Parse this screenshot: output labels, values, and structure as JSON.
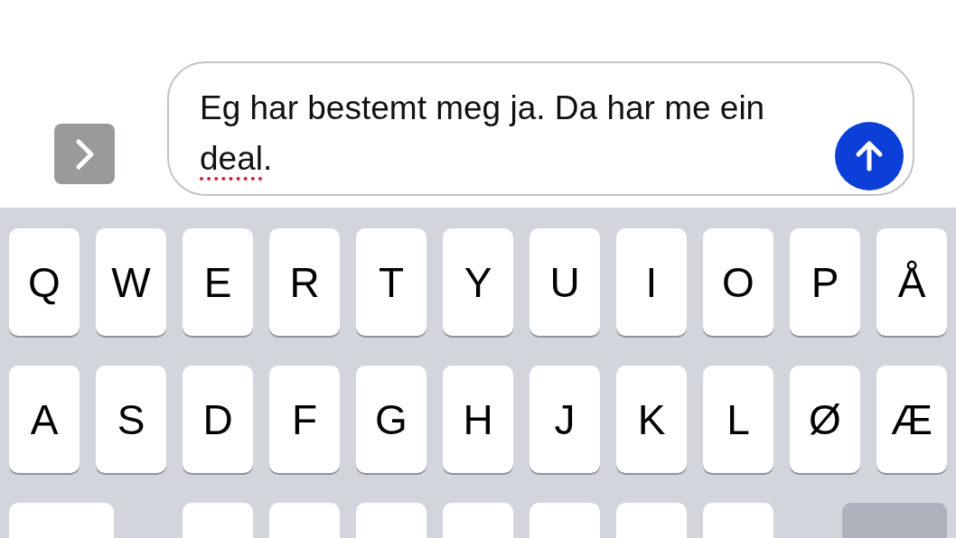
{
  "composer": {
    "expand_button": {
      "kind": "chevron"
    },
    "message": [
      {
        "text": "Eg har bestemt meg ja. Da har me ein ",
        "misspelled": false
      },
      {
        "text": "deal",
        "misspelled": true
      },
      {
        "text": ".",
        "misspelled": false
      }
    ],
    "send_button": {
      "kind": "arrow"
    }
  },
  "keyboard": {
    "rows": [
      {
        "keys": [
          {
            "label": "Q"
          },
          {
            "label": "W"
          },
          {
            "label": "E"
          },
          {
            "label": "R"
          },
          {
            "label": "T"
          },
          {
            "label": "Y"
          },
          {
            "label": "U"
          },
          {
            "label": "I"
          },
          {
            "label": "O"
          },
          {
            "label": "P"
          },
          {
            "label": "Å"
          }
        ]
      },
      {
        "keys": [
          {
            "label": "A"
          },
          {
            "label": "S"
          },
          {
            "label": "D"
          },
          {
            "label": "F"
          },
          {
            "label": "G"
          },
          {
            "label": "H"
          },
          {
            "label": "J"
          },
          {
            "label": "K"
          },
          {
            "label": "L"
          },
          {
            "label": "Ø"
          },
          {
            "label": "Æ"
          }
        ]
      }
    ],
    "bottom_row": [
      {
        "kind": "shift"
      },
      {
        "kind": "letter"
      },
      {
        "kind": "letter"
      },
      {
        "kind": "letter"
      },
      {
        "kind": "letter"
      },
      {
        "kind": "letter"
      },
      {
        "kind": "letter"
      },
      {
        "kind": "letter"
      },
      {
        "kind": "delete"
      }
    ]
  }
}
